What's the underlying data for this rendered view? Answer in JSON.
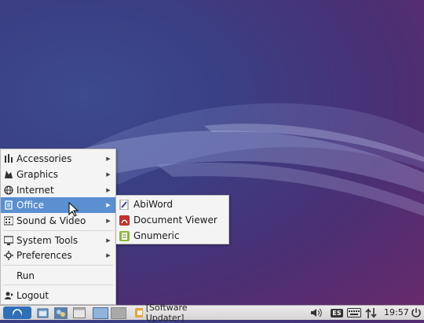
{
  "menu": {
    "items": [
      {
        "label": "Accessories",
        "icon": "accessories-icon",
        "submenu": true
      },
      {
        "label": "Graphics",
        "icon": "graphics-icon",
        "submenu": true
      },
      {
        "label": "Internet",
        "icon": "internet-icon",
        "submenu": true
      },
      {
        "label": "Office",
        "icon": "office-icon",
        "submenu": true,
        "active": true
      },
      {
        "label": "Sound & Video",
        "icon": "sound-video-icon",
        "submenu": true
      },
      {
        "label": "System Tools",
        "icon": "system-tools-icon",
        "submenu": true
      },
      {
        "label": "Preferences",
        "icon": "preferences-icon",
        "submenu": true
      },
      {
        "label": "Run",
        "icon": "",
        "submenu": false
      },
      {
        "label": "Logout",
        "icon": "logout-icon",
        "submenu": false
      }
    ]
  },
  "office_submenu": {
    "items": [
      {
        "label": "AbiWord",
        "icon": "abiword-icon"
      },
      {
        "label": "Document Viewer",
        "icon": "document-viewer-icon"
      },
      {
        "label": "Gnumeric",
        "icon": "gnumeric-icon"
      }
    ]
  },
  "taskbar": {
    "active_window": "[Software Updater]",
    "language": "ES",
    "clock": "19:57"
  },
  "colors": {
    "menu_highlight": "#5a8fd0",
    "desktop_bg": "#3a3f84"
  }
}
